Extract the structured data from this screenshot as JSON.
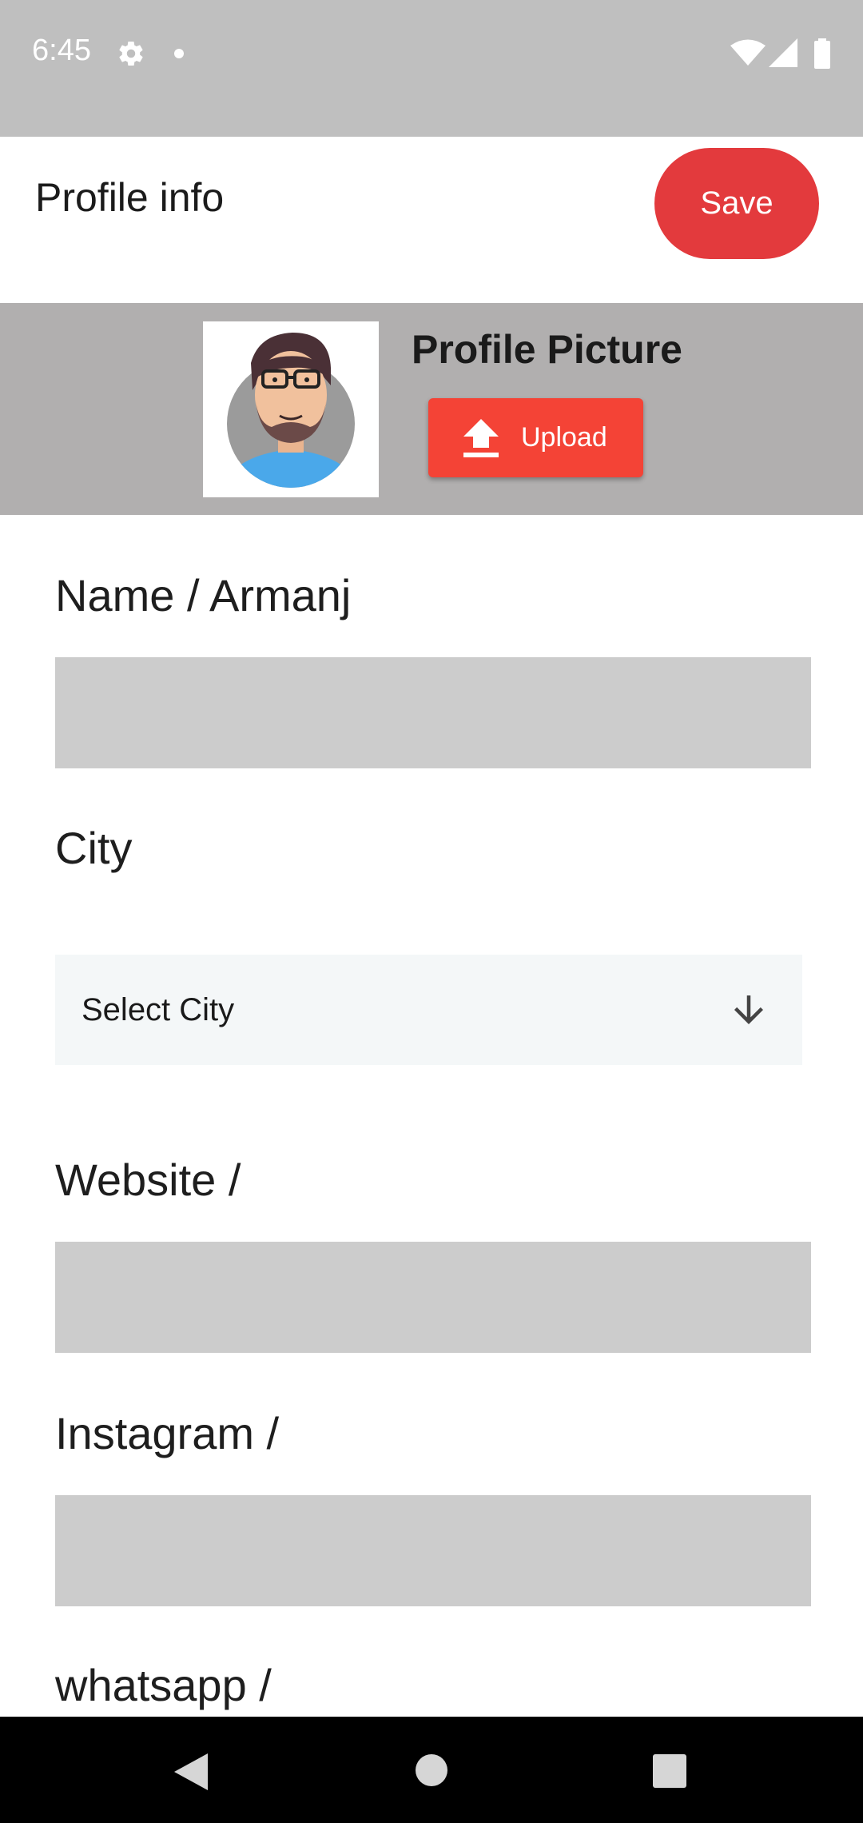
{
  "status_bar": {
    "time": "6:45",
    "icons": [
      "gear-icon",
      "dot-icon",
      "wifi-icon",
      "signal-icon",
      "battery-icon"
    ]
  },
  "header": {
    "title": "Profile info",
    "save_label": "Save",
    "save_color": "#e33a3d"
  },
  "profile_picture": {
    "title": "Profile Picture",
    "upload_label": "Upload",
    "upload_icon": "upload-icon",
    "upload_color": "#f44336"
  },
  "form": {
    "name_label": "Name / Armanj",
    "name_value": "",
    "city_label": "City",
    "city_select_value": "Select City",
    "website_label": "Website /",
    "website_value": "",
    "instagram_label": "Instagram /",
    "instagram_value": "",
    "whatsapp_label": "whatsapp /"
  },
  "nav_bar": {
    "icons": [
      "back-icon",
      "home-icon",
      "recents-icon"
    ]
  }
}
